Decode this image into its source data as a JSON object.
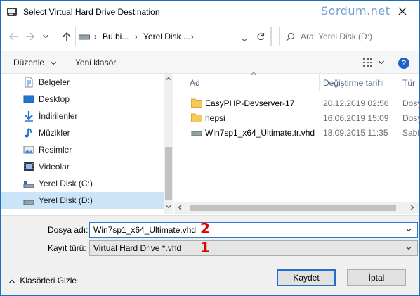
{
  "window": {
    "title": "Select Virtual Hard Drive Destination",
    "watermark": "Sordum.net"
  },
  "address": {
    "crumbs": [
      "Bu bi...",
      "Yerel Disk ..."
    ],
    "search_placeholder": "Ara: Yerel Disk (D:)"
  },
  "toolbar": {
    "organize_label": "Düzenle",
    "new_folder_label": "Yeni klasör",
    "help_label": "?"
  },
  "sidebar": {
    "items": [
      {
        "label": "Belgeler",
        "icon": "documents-icon"
      },
      {
        "label": "Desktop",
        "icon": "desktop-icon"
      },
      {
        "label": "İndirilenler",
        "icon": "downloads-icon"
      },
      {
        "label": "Müzikler",
        "icon": "music-icon"
      },
      {
        "label": "Resimler",
        "icon": "pictures-icon"
      },
      {
        "label": "Videolar",
        "icon": "videos-icon"
      },
      {
        "label": "Yerel Disk (C:)",
        "icon": "system-drive-icon"
      },
      {
        "label": "Yerel Disk (D:)",
        "icon": "drive-icon",
        "selected": true
      }
    ]
  },
  "files": {
    "columns": [
      "Ad",
      "Değiştirme tarihi",
      "Tür"
    ],
    "rows": [
      {
        "name": "EasyPHP-Devserver-17",
        "date": "20.12.2019 02:56",
        "type": "Dosya",
        "icon": "folder-icon"
      },
      {
        "name": "hepsi",
        "date": "16.06.2019 15:09",
        "type": "Dosya",
        "icon": "folder-icon"
      },
      {
        "name": "Win7sp1_x64_Ultimate.tr.vhd",
        "date": "18.09.2015 11:35",
        "type": "Sabit",
        "icon": "vhd-file-icon"
      }
    ]
  },
  "form": {
    "filename_label": "Dosya adı:",
    "filename_value": "Win7sp1_x64_Ultimate.vhd",
    "filetype_label": "Kayıt türü:",
    "filetype_value": "Virtual Hard Drive *.vhd",
    "marker_filename": "2",
    "marker_filetype": "1"
  },
  "footer": {
    "hide_folders_label": "Klasörleri Gizle",
    "save_label": "Kaydet",
    "cancel_label": "İptal"
  },
  "colors": {
    "accent": "#1f6fd0",
    "selection": "#cce4f7",
    "marker": "#e00000",
    "folder": "#f5c95c"
  }
}
